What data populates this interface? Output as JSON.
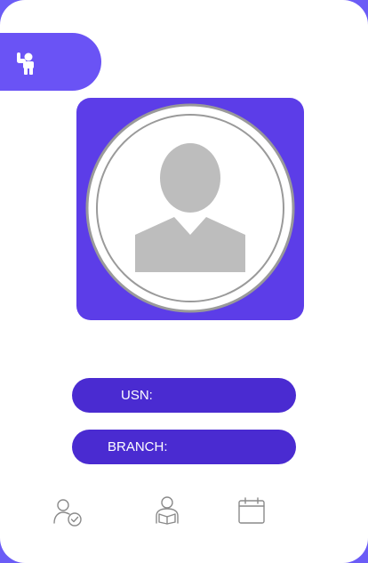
{
  "header": {
    "icon": "raised-hand-person-icon"
  },
  "profile": {
    "avatar_icon": "default-avatar-icon"
  },
  "fields": {
    "usn_label": "USN:",
    "branch_label": "BRANCH:"
  },
  "bottom_nav": {
    "items": [
      {
        "icon": "person-check-icon"
      },
      {
        "icon": "person-reading-icon"
      },
      {
        "icon": "calendar-icon"
      }
    ]
  },
  "colors": {
    "background": "#6b5cf6",
    "header_tab": "#6a53f5",
    "photo_frame": "#5c3de8",
    "field_pill": "#4a2bd1"
  }
}
